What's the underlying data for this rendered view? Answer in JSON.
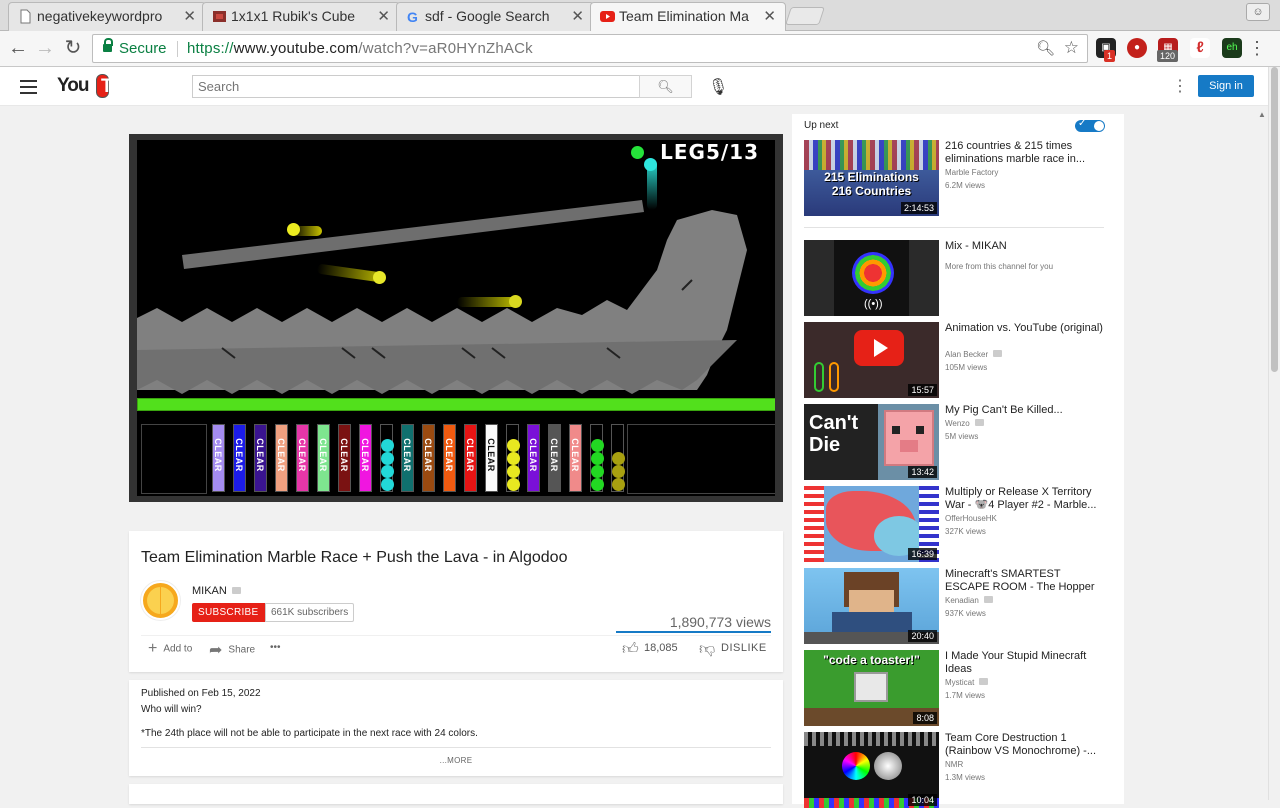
{
  "browser": {
    "tabs": [
      {
        "title": "negativekeywordpro",
        "icon": "page-icon"
      },
      {
        "title": "1x1x1 Rubik's Cube",
        "icon": "cube-icon"
      },
      {
        "title": "sdf - Google Search",
        "icon": "google-icon"
      },
      {
        "title": "Team Elimination Ma",
        "icon": "youtube-icon",
        "active": true
      }
    ],
    "secure_label": "Secure",
    "url_scheme": "https://",
    "url_host": "www.youtube.com",
    "url_path": "/watch?v=aR0HYnZhACk",
    "ext_badge_1": "1",
    "ext_badge_2": "120"
  },
  "yt": {
    "logo_you": "You",
    "logo_tube": "Tube",
    "search_placeholder": "Search",
    "signin": "Sign in"
  },
  "player": {
    "overlay": "LEG5/13",
    "tube_label": "CLEAR"
  },
  "video": {
    "title": "Team Elimination Marble Race + Push the Lava - in Algodoo",
    "channel": "MIKAN",
    "subscribe": "SUBSCRIBE",
    "subscribers": "661K subscribers",
    "views": "1,890,773 views",
    "add_to": "Add to",
    "share": "Share",
    "more": "•••",
    "likes": "18,085",
    "dislike": "DISLIKE"
  },
  "description": {
    "published": "Published on Feb 15, 2022",
    "line1": "Who will win?",
    "line2": "*The 24th place will not be able to participate in the next race with 24 colors.",
    "more": "...MORE"
  },
  "upnext": {
    "label": "Up next",
    "autoplay_on": true,
    "videos": [
      {
        "title": "216 countries & 215 times eliminations marble race in...",
        "channel": "Marble Factory",
        "views": "6.2M views",
        "duration": "2:14:53",
        "thumb_text": "215 Eliminations\n216 Countries"
      },
      {
        "title": "Mix - MIKAN",
        "channel": "More from this channel for you",
        "views": "",
        "duration": ""
      },
      {
        "title": "Animation vs. YouTube (original)",
        "channel": "Alan Becker",
        "views": "105M views",
        "duration": "15:57"
      },
      {
        "title": "My Pig Can't Be Killed...",
        "channel": "Wenzo",
        "views": "5M views",
        "duration": "13:42",
        "thumb_text": "Can't Die"
      },
      {
        "title": "Multiply or Release X Territory War - 🐨4 Player #2 - Marble...",
        "channel": "OfferHouseHK",
        "views": "327K views",
        "duration": "16:39"
      },
      {
        "title": "Minecraft's SMARTEST ESCAPE ROOM - The Hopper",
        "channel": "Kenadian",
        "views": "937K views",
        "duration": "20:40"
      },
      {
        "title": "I Made Your Stupid Minecraft Ideas",
        "channel": "Mysticat",
        "views": "1.7M views",
        "duration": "8:08",
        "thumb_text": "\"code a toaster!\""
      },
      {
        "title": "Team Core Destruction 1 (Rainbow VS Monochrome) -...",
        "channel": "NMR",
        "views": "1.3M views",
        "duration": "10:04"
      }
    ]
  },
  "colors": {
    "yt_red": "#e62117",
    "yt_blue": "#167ac6",
    "secure_green": "#0b8043",
    "lava_green": "#52e01c"
  }
}
